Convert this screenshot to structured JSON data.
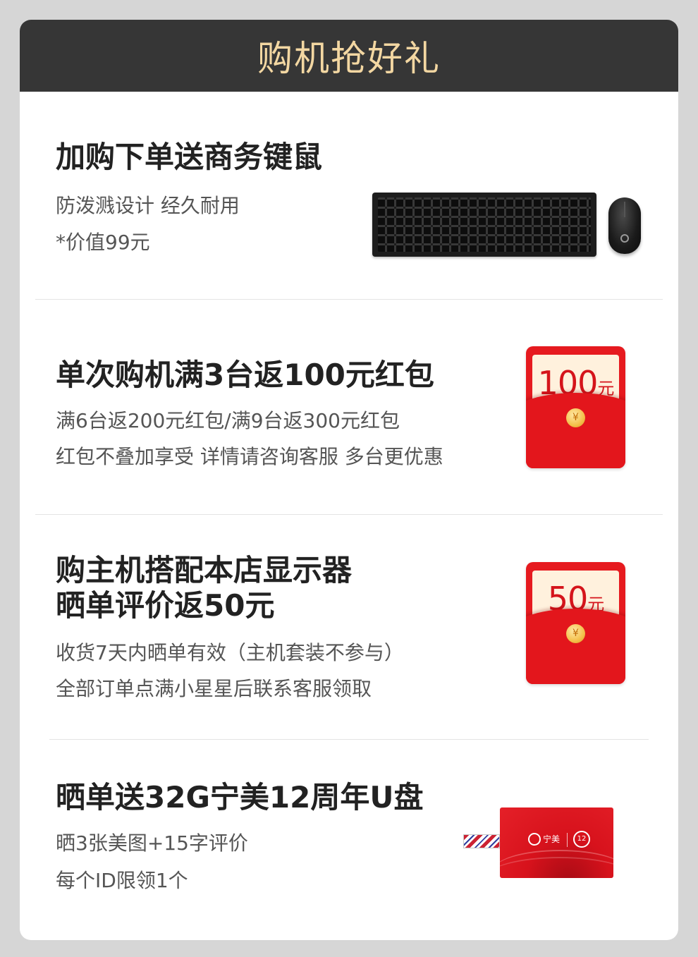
{
  "header": {
    "title": "购机抢好礼"
  },
  "promos": [
    {
      "title": "加购下单送商务键鼠",
      "lines": [
        "防泼溅设计 经久耐用",
        "*价值99元"
      ],
      "image": "keyboard-mouse"
    },
    {
      "title": "单次购机满3台返100元红包",
      "lines": [
        "满6台返200元红包/满9台返300元红包",
        "红包不叠加享受 详情请咨询客服 多台更优惠"
      ],
      "image": "red-envelope",
      "envelope_amount": "100",
      "envelope_unit": "元"
    },
    {
      "title_lines": [
        "购主机搭配本店显示器",
        "晒单评价返50元"
      ],
      "lines": [
        "收货7天内晒单有效（主机套装不参与）",
        "全部订单点满小星星后联系客服领取"
      ],
      "image": "red-envelope",
      "envelope_amount": "50",
      "envelope_unit": "元"
    },
    {
      "title": "晒单送32G宁美12周年U盘",
      "lines": [
        "晒3张美图+15字评价",
        "每个ID限领1个"
      ],
      "image": "usb-card",
      "usb_brand": "宁美",
      "usb_badge": "12"
    }
  ],
  "coin_symbol": "¥",
  "colors": {
    "header_bg": "#363636",
    "header_text": "#f3d7a2",
    "envelope_red": "#e61a1f",
    "page_bg": "#d6d6d6"
  }
}
